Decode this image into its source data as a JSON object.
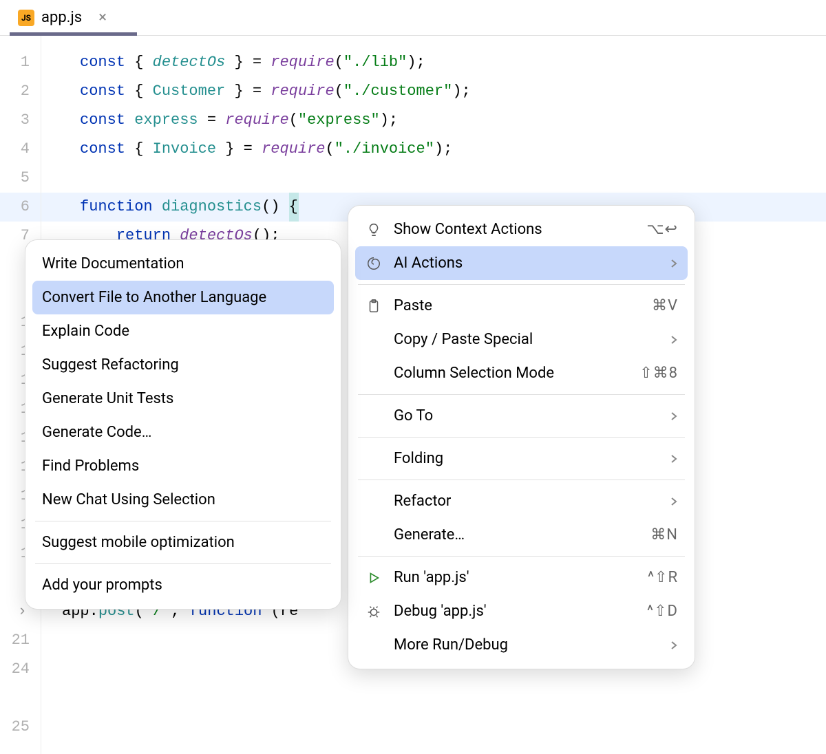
{
  "tab": {
    "icon_text": "JS",
    "label": "app.js"
  },
  "gutter_numbers": [
    "1",
    "2",
    "3",
    "4",
    "5",
    "6",
    "7",
    "",
    "",
    "1",
    "1",
    "1",
    "1",
    "1",
    "1",
    "1",
    "1",
    "1",
    "",
    "21",
    "",
    "24",
    "",
    "25"
  ],
  "code": {
    "l1": {
      "kw": "const",
      "brace_open": " { ",
      "name": "detectOs",
      "brace_close": " } = ",
      "fn": "require",
      "paren_open": "(",
      "str": "\"./lib\"",
      "paren_close": ");"
    },
    "l2": {
      "kw": "const",
      "brace_open": " { ",
      "name": "Customer",
      "brace_close": " } = ",
      "fn": "require",
      "paren_open": "(",
      "str": "\"./customer\"",
      "paren_close": ");"
    },
    "l3": {
      "kw": "const",
      "sp": " ",
      "name": "express",
      "eq": " = ",
      "fn": "require",
      "paren_open": "(",
      "str": "\"express\"",
      "paren_close": ");"
    },
    "l4": {
      "kw": "const",
      "brace_open": " { ",
      "name": "Invoice",
      "brace_close": " } = ",
      "fn": "require",
      "paren_open": "(",
      "str": "\"./invoice\"",
      "paren_close": ");"
    },
    "l6a": {
      "kw": "function",
      "sp": " ",
      "name": "diagnostics",
      "parens": "()",
      "sp2": " ",
      "brace": "{"
    },
    "l7": {
      "indent": "    ",
      "kw": "return",
      "sp": " ",
      "name": "detectOs",
      "call": "();"
    },
    "l21": {
      "obj": "app.",
      "method": "post",
      "paren": "(",
      "str": "'/'",
      "comma": ", ",
      "kw": "function",
      "sp": " ",
      "rest": "(re"
    }
  },
  "submenu": {
    "items": [
      {
        "label": "Write Documentation"
      },
      {
        "label": "Convert File to Another Language",
        "hl": true
      },
      {
        "label": "Explain Code"
      },
      {
        "label": "Suggest Refactoring"
      },
      {
        "label": "Generate Unit Tests"
      },
      {
        "label": "Generate Code…"
      },
      {
        "label": "Find Problems"
      },
      {
        "label": "New Chat Using Selection"
      },
      {
        "sep": true
      },
      {
        "label": "Suggest mobile optimization"
      },
      {
        "sep": true
      },
      {
        "label": "Add your prompts"
      }
    ]
  },
  "mainmenu": {
    "items": [
      {
        "icon": "bulb",
        "label": "Show Context Actions",
        "shortcut": "⌥↩"
      },
      {
        "icon": "spiral",
        "label": "AI Actions",
        "chev": true,
        "hl": true
      },
      {
        "sep": true
      },
      {
        "icon": "clipboard",
        "label": "Paste",
        "shortcut": "⌘V"
      },
      {
        "label": "Copy / Paste Special",
        "chev": true
      },
      {
        "label": "Column Selection Mode",
        "shortcut": "⇧⌘8"
      },
      {
        "sep": true
      },
      {
        "label": "Go To",
        "chev": true
      },
      {
        "sep": true
      },
      {
        "label": "Folding",
        "chev": true
      },
      {
        "sep": true
      },
      {
        "label": "Refactor",
        "chev": true
      },
      {
        "label": "Generate…",
        "shortcut": "⌘N"
      },
      {
        "sep": true
      },
      {
        "icon": "play",
        "label": "Run 'app.js'",
        "shortcut": "^⇧R"
      },
      {
        "icon": "bug",
        "label": "Debug 'app.js'",
        "shortcut": "^⇧D"
      },
      {
        "label": "More Run/Debug",
        "chev": true
      }
    ]
  }
}
